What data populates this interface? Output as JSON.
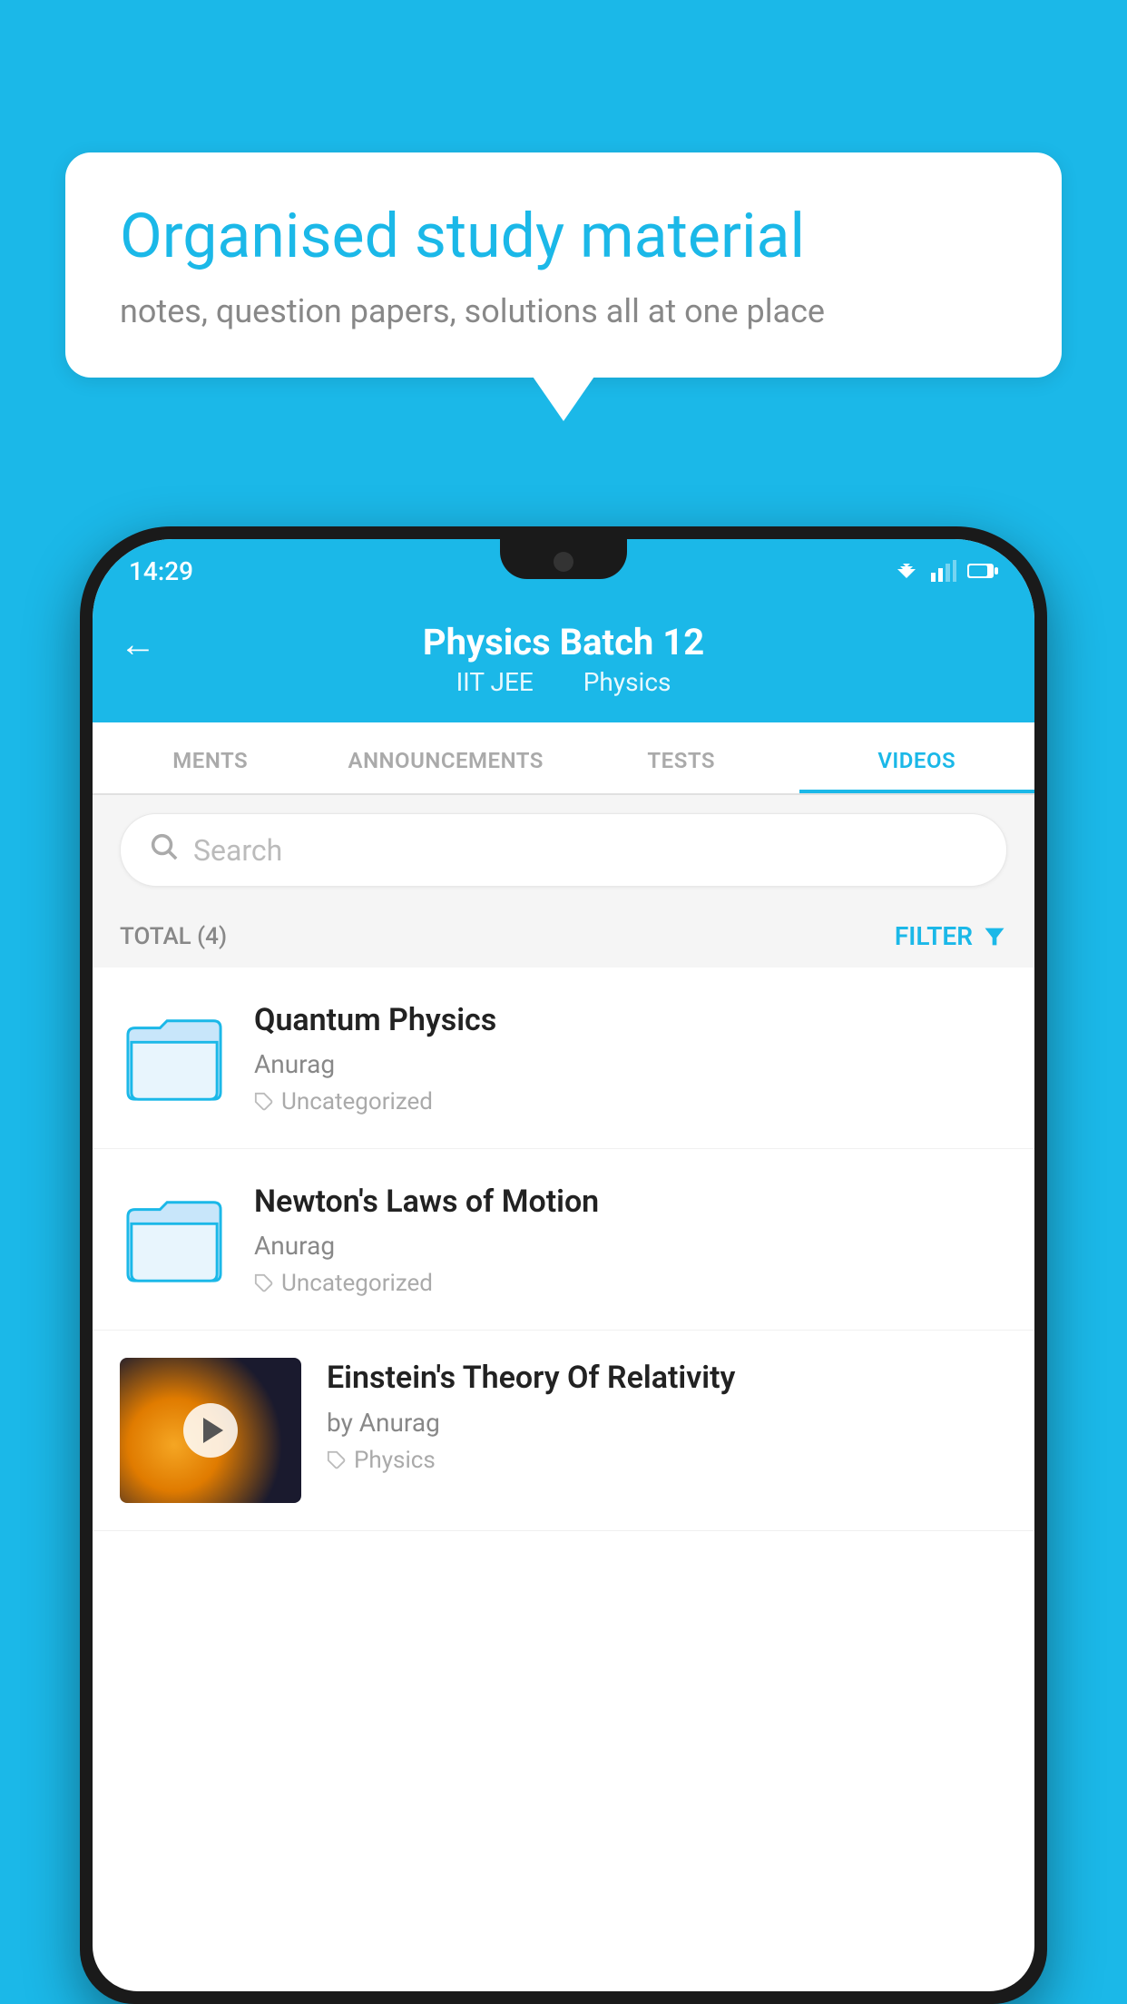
{
  "background_color": "#1bb8e8",
  "bubble": {
    "title": "Organised study material",
    "subtitle": "notes, question papers, solutions all at one place"
  },
  "status_bar": {
    "time": "14:29"
  },
  "app_bar": {
    "title": "Physics Batch 12",
    "subtitle1": "IIT JEE",
    "subtitle2": "Physics",
    "back_label": "←"
  },
  "tabs": [
    {
      "label": "MENTS",
      "active": false
    },
    {
      "label": "ANNOUNCEMENTS",
      "active": false
    },
    {
      "label": "TESTS",
      "active": false
    },
    {
      "label": "VIDEOS",
      "active": true
    }
  ],
  "search": {
    "placeholder": "Search"
  },
  "filter_bar": {
    "total_label": "TOTAL (4)",
    "filter_label": "FILTER"
  },
  "videos": [
    {
      "id": 1,
      "title": "Quantum Physics",
      "author": "Anurag",
      "tag": "Uncategorized",
      "type": "folder",
      "has_thumbnail": false
    },
    {
      "id": 2,
      "title": "Newton's Laws of Motion",
      "author": "Anurag",
      "tag": "Uncategorized",
      "type": "folder",
      "has_thumbnail": false
    },
    {
      "id": 3,
      "title": "Einstein's Theory Of Relativity",
      "author": "by Anurag",
      "tag": "Physics",
      "type": "video",
      "has_thumbnail": true
    }
  ]
}
